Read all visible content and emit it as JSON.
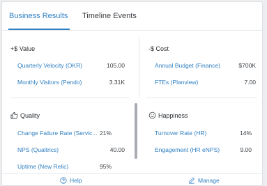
{
  "tabs": [
    {
      "label": "Business Results",
      "active": true
    },
    {
      "label": "Timeline Events",
      "active": false
    }
  ],
  "value_section": {
    "title": "+$ Value",
    "rows": [
      {
        "label": "Quarterly Velocity (OKR)",
        "value": "105.00"
      },
      {
        "label": "Monthly Visitors (Pendo)",
        "value": "3.31K"
      }
    ]
  },
  "cost_section": {
    "title": "-$ Cost",
    "rows": [
      {
        "label": "Annual Budget (Finance)",
        "value": "$700K"
      },
      {
        "label": "FTEs (Planview)",
        "value": "7.00"
      }
    ]
  },
  "quality_section": {
    "title": "Quality",
    "icon": "thumbs-up-icon",
    "rows": [
      {
        "label": "Change Failure Rate (Servic...",
        "value": "21%"
      },
      {
        "label": "NPS (Qualtrics)",
        "value": "40.00"
      },
      {
        "label": "Uptime (New Relic)",
        "value": "95%"
      }
    ]
  },
  "happiness_section": {
    "title": "Happiness",
    "icon": "smiley-icon",
    "rows": [
      {
        "label": "Turnover Rate (HR)",
        "value": "14%"
      },
      {
        "label": "Engagement (HR eNPS)",
        "value": "9.00"
      }
    ]
  },
  "footer": {
    "help_label": "Help",
    "manage_label": "Manage"
  },
  "colors": {
    "accent": "#2f7fc1",
    "text": "#2b2f33",
    "divider": "#e6e8eb"
  }
}
